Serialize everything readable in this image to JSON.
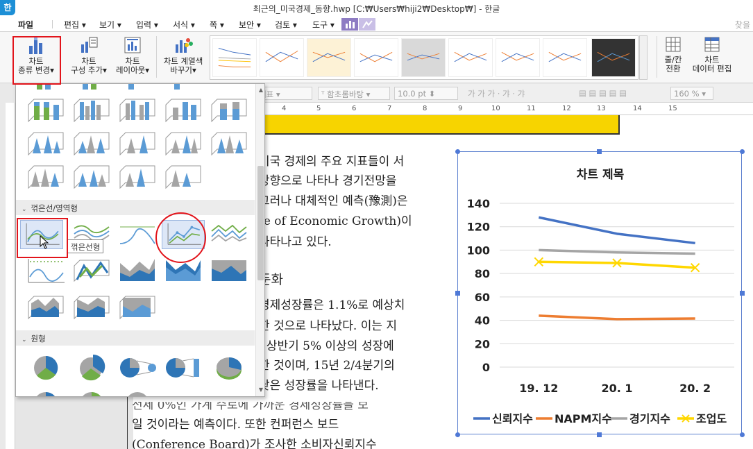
{
  "window": {
    "title": "최근의_미국경제_동향.hwp [C:₩Users₩hiji2₩Desktop₩] - 한글",
    "app_icon_label": "한"
  },
  "menu": {
    "items": [
      "파일",
      "편집",
      "보기",
      "입력",
      "서식",
      "쪽",
      "보안",
      "검토",
      "도구"
    ],
    "right_label": "찾을"
  },
  "ribbon": {
    "chart_type_change": [
      "차트",
      "종류 변경"
    ],
    "chart_composition_add": [
      "차트",
      "구성 추가"
    ],
    "chart_layout": [
      "차트",
      "레이아웃"
    ],
    "chart_color_change": [
      "차트 계열색",
      "바꾸기"
    ],
    "row_col_switch": [
      "줄/칸",
      "전환"
    ],
    "chart_data_edit": [
      "차트",
      "데이터 편집"
    ]
  },
  "toolbar2": {
    "style_name": "대표",
    "font_name": "함초롬바탕",
    "font_size": "10.0",
    "font_unit": "pt",
    "zoom": "160"
  },
  "ruler": {
    "numbers": [
      "4",
      "5",
      "6",
      "7",
      "8",
      "9",
      "10",
      "11",
      "12",
      "13",
      "14",
      "15"
    ]
  },
  "dropdown": {
    "sections": {
      "line_area": "꺾은선/영역형",
      "pie": "원형"
    },
    "tooltip": "꺾은선형"
  },
  "document": {
    "lines": [
      "미국 경제의 주요 지표들이 서",
      "방향으로 나타나 경기전망을",
      "그러나 대체적인 예측(豫測)은",
      "te of Economic Growth)이",
      "나타나고 있다."
    ],
    "heading": "둔화",
    "body_lines": [
      "경제성장률은 1.1%로 예상치",
      "한 것으로 나타났다. 이는 지",
      ", 상반기 5% 이상의 성장에",
      "한 것이며, 15년 2/4분기의",
      "낮은 성장률을 나타낸다."
    ],
    "bottom_lines": [
      "일 것이라는 예측이다. 또한 컨퍼런스 보드",
      "(Conference Board)가 조사한 소비자신뢰지수"
    ],
    "partial_line": "전세 0%인 가계 수로에 가까운 경제성장률을 보"
  },
  "chart_data": {
    "type": "line",
    "title": "차트 제목",
    "categories": [
      "19. 12",
      "20. 1",
      "20. 2"
    ],
    "ylim": [
      0,
      140
    ],
    "yticks": [
      0,
      20,
      40,
      60,
      80,
      100,
      120,
      140
    ],
    "grid": true,
    "legend_position": "bottom",
    "series": [
      {
        "name": "신뢰지수",
        "values": [
          128,
          114,
          106
        ],
        "color": "#4472c4",
        "marker": "none"
      },
      {
        "name": "NAPM지수",
        "values": [
          44,
          41,
          41.5
        ],
        "color": "#ed7d31",
        "marker": "none"
      },
      {
        "name": "경기지수",
        "values": [
          100,
          98,
          97
        ],
        "color": "#a5a5a5",
        "marker": "none"
      },
      {
        "name": "조업도",
        "values": [
          90,
          89,
          85
        ],
        "color": "#ffd700",
        "marker": "x"
      }
    ]
  },
  "colors": {
    "annotation_red": "#e2141b",
    "selection_blue": "#4f79d6"
  }
}
